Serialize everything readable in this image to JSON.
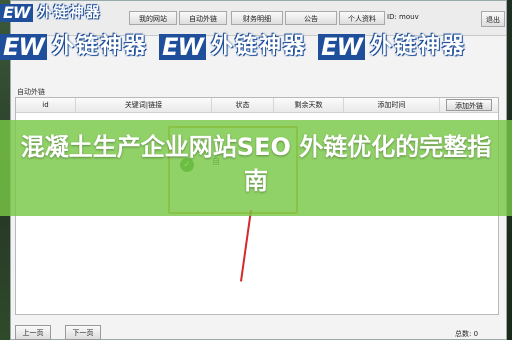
{
  "nav": {
    "tabs": [
      "我的网站",
      "自动外链",
      "财务明细",
      "公告",
      "个人资料"
    ],
    "id_label": "ID: mouv",
    "exit_label": "退出"
  },
  "section": {
    "title": "自动外链"
  },
  "table": {
    "columns": [
      "id",
      "关键词|链接",
      "状态",
      "剩余天数",
      "添加时间"
    ],
    "add_button": "添加外链",
    "rows": []
  },
  "dialog": {
    "icon": "success-icon",
    "text": "自"
  },
  "pagination": {
    "prev_label": "上一页",
    "next_label": "下一页",
    "total_text": "总数: 0"
  },
  "watermark": {
    "logo": "EW",
    "text": "外链神器"
  },
  "banner": {
    "title": "混凝土生产企业网站SEO 外链优化的完整指南"
  },
  "colors": {
    "banner_green": "#78c846",
    "watermark_blue": "#1f4f9a",
    "dialog_border": "#d8a640",
    "red_line": "#d42a2a"
  }
}
